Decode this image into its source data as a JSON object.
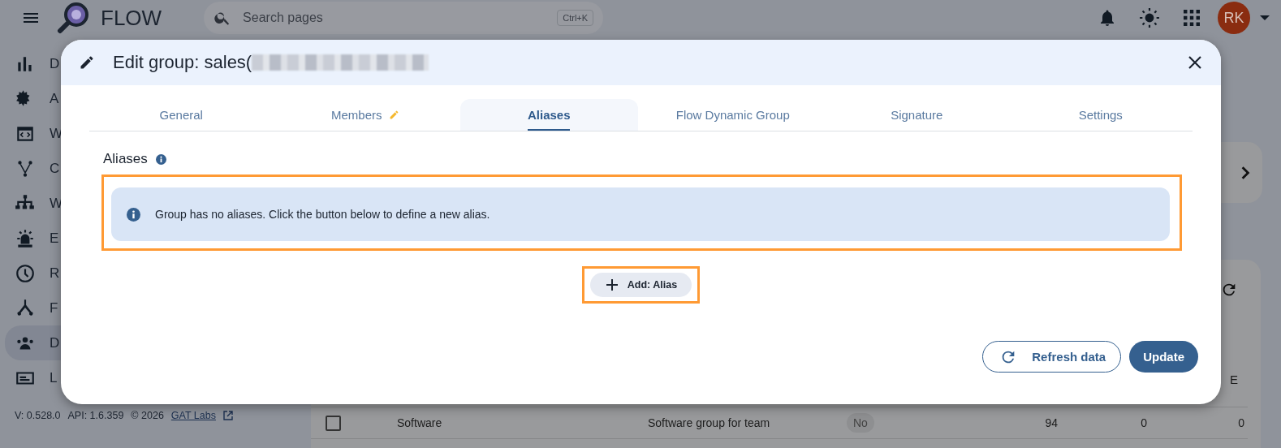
{
  "topbar": {
    "app_name": "FLOW",
    "search": {
      "placeholder": "Search pages",
      "shortcut": "Ctrl+K"
    },
    "avatar": "RK"
  },
  "sidebar": {
    "items": [
      {
        "label": "D",
        "selected": false
      },
      {
        "label": "A",
        "selected": false
      },
      {
        "label": "W",
        "selected": false
      },
      {
        "label": "C",
        "selected": false
      },
      {
        "label": "W",
        "selected": false
      },
      {
        "label": "E",
        "selected": false
      },
      {
        "label": "R",
        "selected": false
      },
      {
        "label": "F",
        "selected": false
      },
      {
        "label": "D",
        "selected": true
      },
      {
        "label": "L",
        "selected": false
      }
    ],
    "footer": {
      "version": "V: 0.528.0",
      "api": "API: 1.6.359",
      "copyright": "© 2026",
      "link": "GAT Labs"
    }
  },
  "table": {
    "column_header": "E",
    "row": {
      "checked": false,
      "name": "Software",
      "description": "Software group for team",
      "badge": "No",
      "cells": [
        "94",
        "0",
        "0"
      ]
    }
  },
  "dialog": {
    "title": "Edit group: sales(",
    "tabs": [
      {
        "label": "General",
        "selected": false,
        "edited": false
      },
      {
        "label": "Members",
        "selected": false,
        "edited": true
      },
      {
        "label": "Aliases",
        "selected": true,
        "edited": false
      },
      {
        "label": "Flow Dynamic Group",
        "selected": false,
        "edited": false
      },
      {
        "label": "Signature",
        "selected": false,
        "edited": false
      },
      {
        "label": "Settings",
        "selected": false,
        "edited": false
      }
    ],
    "section_title": "Aliases",
    "alert": "Group has no aliases. Click the button below to define a new alias.",
    "add_button": "Add: Alias",
    "refresh_button": "Refresh data",
    "update_button": "Update"
  }
}
